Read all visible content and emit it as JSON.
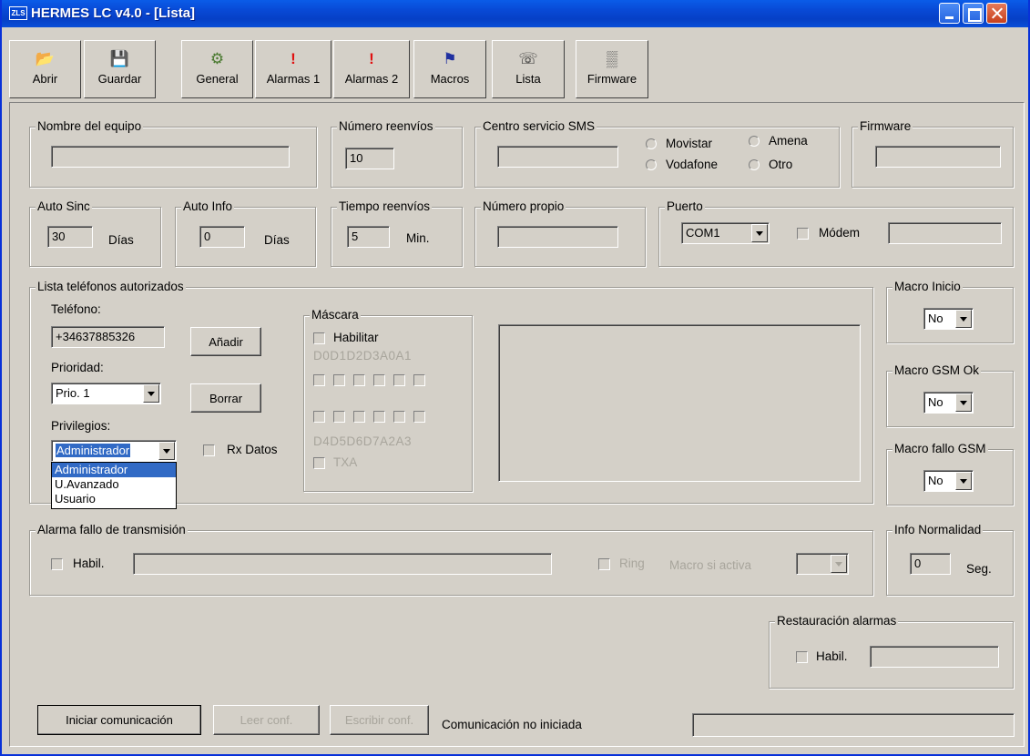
{
  "window": {
    "title": "HERMES LC v4.0 - [Lista]",
    "icon_text": "ZLS"
  },
  "toolbar": [
    {
      "label": "Abrir",
      "icon": "open-folder-icon"
    },
    {
      "label": "Guardar",
      "icon": "floppy-disk-icon"
    },
    {
      "label": "General",
      "icon": "gears-icon"
    },
    {
      "label": "Alarmas 1",
      "icon": "exclamation-icon"
    },
    {
      "label": "Alarmas 2",
      "icon": "exclamation-icon"
    },
    {
      "label": "Macros",
      "icon": "macro-icon"
    },
    {
      "label": "Lista",
      "icon": "phone-list-icon"
    },
    {
      "label": "Firmware",
      "icon": "chip-icon"
    }
  ],
  "device_name": {
    "caption": "Nombre del equipo",
    "value": ""
  },
  "resends": {
    "caption": "Número reenvíos",
    "value": "10"
  },
  "sms_center": {
    "caption": "Centro servicio SMS",
    "value": "",
    "options": [
      "Movistar",
      "Amena",
      "Vodafone",
      "Otro"
    ]
  },
  "firmware_group": {
    "caption": "Firmware",
    "value": ""
  },
  "auto_sync": {
    "caption": "Auto Sinc",
    "value": "30",
    "unit": "Días"
  },
  "auto_info": {
    "caption": "Auto Info",
    "value": "0",
    "unit": "Días"
  },
  "resend_time": {
    "caption": "Tiempo reenvíos",
    "value": "5",
    "unit": "Min."
  },
  "own_number": {
    "caption": "Número propio",
    "value": ""
  },
  "port": {
    "caption": "Puerto",
    "value": "COM1",
    "modem_label": "Módem",
    "modem_value": ""
  },
  "phones": {
    "caption": "Lista teléfonos autorizados",
    "phone_label": "Teléfono:",
    "phone_value": "+34637885326",
    "add_label": "Añadir",
    "priority_label": "Prioridad:",
    "priority_value": "Prio. 1",
    "delete_label": "Borrar",
    "privileges_label": "Privilegios:",
    "privileges_value": "Administrador",
    "privileges_options": [
      "Administrador",
      "U.Avanzado",
      "Usuario"
    ],
    "rx_label": "Rx Datos"
  },
  "mask": {
    "caption": "Máscara",
    "enable_label": "Habilitar",
    "top_labels": "D0D1D2D3A0A1",
    "bottom_labels": "D4D5D6D7A2A3",
    "txa_label": "TXA"
  },
  "macro_start": {
    "caption": "Macro Inicio",
    "value": "No"
  },
  "macro_gsm_ok": {
    "caption": "Macro GSM Ok",
    "value": "No"
  },
  "macro_gsm_fail": {
    "caption": "Macro fallo GSM",
    "value": "No"
  },
  "tx_alarm": {
    "caption": "Alarma fallo de transmisión",
    "enable_label": "Habil.",
    "value": "",
    "ring_label": "Ring",
    "macro_label": "Macro si activa"
  },
  "info_normal": {
    "caption": "Info Normalidad",
    "value": "0",
    "unit": "Seg."
  },
  "alarm_restore": {
    "caption": "Restauración alarmas",
    "enable_label": "Habil.",
    "value": ""
  },
  "bottom": {
    "start_label": "Iniciar comunicación",
    "read_label": "Leer conf.",
    "write_label": "Escribir conf.",
    "status": "Comunicación no iniciada"
  }
}
